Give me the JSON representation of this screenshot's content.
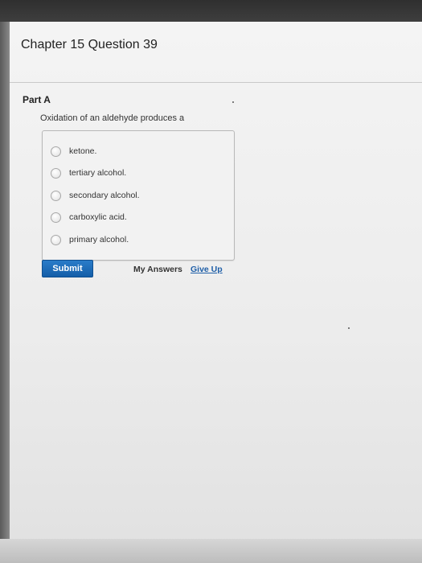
{
  "header": {
    "chapter_title": "Chapter 15 Question 39"
  },
  "question": {
    "part_label": "Part A",
    "prompt": "Oxidation of an aldehyde produces a",
    "options": [
      "ketone.",
      "tertiary alcohol.",
      "secondary alcohol.",
      "carboxylic acid.",
      "primary alcohol."
    ]
  },
  "actions": {
    "submit_label": "Submit",
    "my_answers_label": "My Answers",
    "give_up_label": "Give Up"
  },
  "colors": {
    "submit_button": "#1a6bb8",
    "link": "#1f5fa8"
  }
}
